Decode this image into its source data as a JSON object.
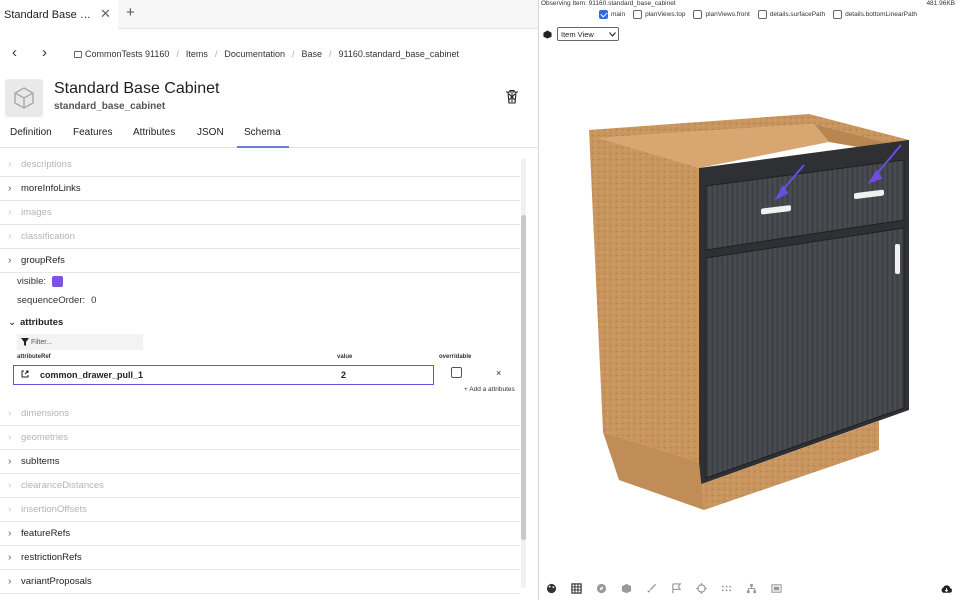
{
  "tab": {
    "title": "Standard Base C...",
    "close": "✕",
    "add": "+"
  },
  "nav": {
    "back": "‹",
    "forward": "›",
    "breadcrumbs": [
      "CommonTests 91160",
      "Items",
      "Documentation",
      "Base",
      "91160.standard_base_cabinet"
    ],
    "sep": "/"
  },
  "item": {
    "title": "Standard Base Cabinet",
    "subtitle": "standard_base_cabinet"
  },
  "panel_tabs": [
    "Definition",
    "Features",
    "Attributes",
    "JSON",
    "Schema"
  ],
  "active_tab": "Schema",
  "schema": {
    "rows_top": [
      {
        "label": "descriptions",
        "enabled": false
      },
      {
        "label": "moreInfoLinks",
        "enabled": true
      },
      {
        "label": "images",
        "enabled": false
      },
      {
        "label": "classification",
        "enabled": false
      },
      {
        "label": "groupRefs",
        "enabled": true
      }
    ],
    "visible_label": "visible:",
    "sequence_label": "sequenceOrder:",
    "sequence_value": "0",
    "attributes_label": "attributes",
    "filter_placeholder": "Filter...",
    "columns": {
      "ref": "attributeRef",
      "value": "value",
      "overridable": "overridable"
    },
    "attr_name": "common_drawer_pull_1",
    "attr_value": "2",
    "remove": "×",
    "add_attr": "+ Add a attributes",
    "rows_bottom": [
      {
        "label": "dimensions",
        "enabled": false
      },
      {
        "label": "geometries",
        "enabled": false
      },
      {
        "label": "subItems",
        "enabled": true
      },
      {
        "label": "clearanceDistances",
        "enabled": false
      },
      {
        "label": "insertionOffsets",
        "enabled": false
      },
      {
        "label": "featureRefs",
        "enabled": true
      },
      {
        "label": "restrictionRefs",
        "enabled": true
      },
      {
        "label": "variantProposals",
        "enabled": true
      }
    ]
  },
  "viewer": {
    "observing": "Observing Item: 91160.standard_base_cabinet",
    "size": "481.96KB",
    "layers": [
      {
        "label": "main",
        "checked": true
      },
      {
        "label": "planViews.top",
        "checked": false
      },
      {
        "label": "planViews.front",
        "checked": false
      },
      {
        "label": "details.surfacePath",
        "checked": false
      },
      {
        "label": "details.bottomLinearPath",
        "checked": false
      }
    ],
    "view_select": "Item View"
  },
  "colors": {
    "accent": "#6c4de0",
    "tab_underline": "#6a7fd0",
    "cabinet_front": "#3f4246",
    "particle_board": "#c9955f"
  }
}
